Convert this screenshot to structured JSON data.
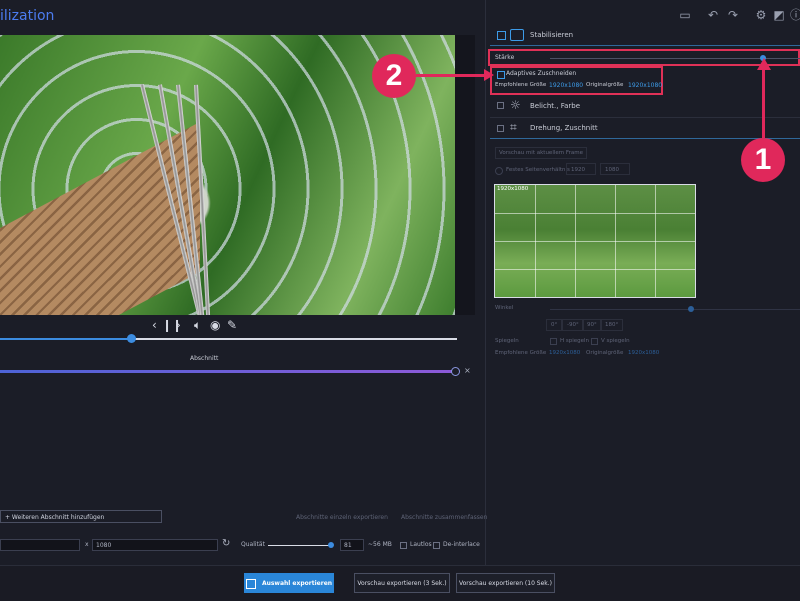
{
  "header": {
    "title_fragment": "ilization",
    "icons": [
      "folder-icon",
      "undo-icon",
      "redo-icon",
      "settings-icon",
      "theme-icon",
      "info-icon"
    ]
  },
  "player": {
    "prev_label": "‹",
    "pause_label": "❙❙",
    "next_label": "›",
    "progress": 0.29
  },
  "timeline": {
    "section_label": "Abschnitt",
    "close_label": "×",
    "add_section_label": "+ Weiteren Abschnitt hinzufügen",
    "export_separately_label": "Abschnitte einzeln exportieren",
    "merge_label": "Abschnitte zusammenfassen"
  },
  "output": {
    "width_value": "",
    "separator": "x",
    "height_value": "1080",
    "quality_label": "Qualität",
    "quality_value": "81",
    "size_estimate": "~56 MB",
    "lossless_label": "Lautlos",
    "deinterlace_label": "De-interlace"
  },
  "right_panel": {
    "stabilize_label": "Stabilisieren",
    "strength_label": "Stärke",
    "adaptive_crop_label": "Adaptives Zuschneiden",
    "recommended_size_label": "Empfohlene Größe",
    "recommended_size_value": "1920x1080",
    "original_size_label": "Originalgröße",
    "original_size_value": "1920x1080",
    "exposure_label": "Belicht., Farbe",
    "rotation_label": "Drehung, Zuschnitt",
    "preview_frame_label": "Vorschau mit aktuellem Frame",
    "fixed_ratio_label": "Festes Seitenverhältnis",
    "ratio_w": "1920",
    "ratio_h": "1080",
    "thumb_overlay": "1920x1080",
    "angle_label": "Winkel",
    "angle_buttons": [
      "0°",
      "-90°",
      "90°",
      "180°"
    ],
    "mirror_label": "Spiegeln",
    "h_mirror_label": "H spiegeln",
    "v_mirror_label": "V spiegeln",
    "recommended_size_label2": "Empfohlene Größe",
    "recommended_size_value2": "1920x1080",
    "original_size_label2": "Originalgröße",
    "original_size_value2": "1920x1080"
  },
  "footer": {
    "export_selection_label": "Auswahl exportieren",
    "preview_3_label": "Vorschau exportieren (3 Sek.)",
    "preview_10_label": "Vorschau exportieren (10 Sek.)"
  },
  "annotations": {
    "badge_1": "1",
    "badge_2": "2"
  },
  "colors": {
    "accent": "#2a86d8",
    "annotation_red": "#e0285b",
    "section_gradient_start": "#4d63d6",
    "section_gradient_end": "#8d5ad8"
  }
}
